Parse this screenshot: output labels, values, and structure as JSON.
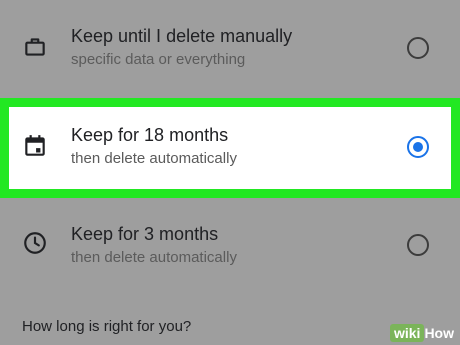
{
  "options": [
    {
      "title": "Keep until I delete manually",
      "subtitle": "specific data or everything",
      "icon": "briefcase-icon",
      "selected": false
    },
    {
      "title": "Keep for 18 months",
      "subtitle": "then delete automatically",
      "icon": "calendar-icon",
      "selected": true
    },
    {
      "title": "Keep for 3 months",
      "subtitle": "then delete automatically",
      "icon": "clock-icon",
      "selected": false
    }
  ],
  "help": {
    "title": "How long is right for you?"
  },
  "watermark": {
    "prefix": "wiki",
    "suffix": "How"
  },
  "colors": {
    "highlight": "#22e822",
    "radio_selected": "#1a73e8",
    "dim_background": "#9e9e9e"
  }
}
